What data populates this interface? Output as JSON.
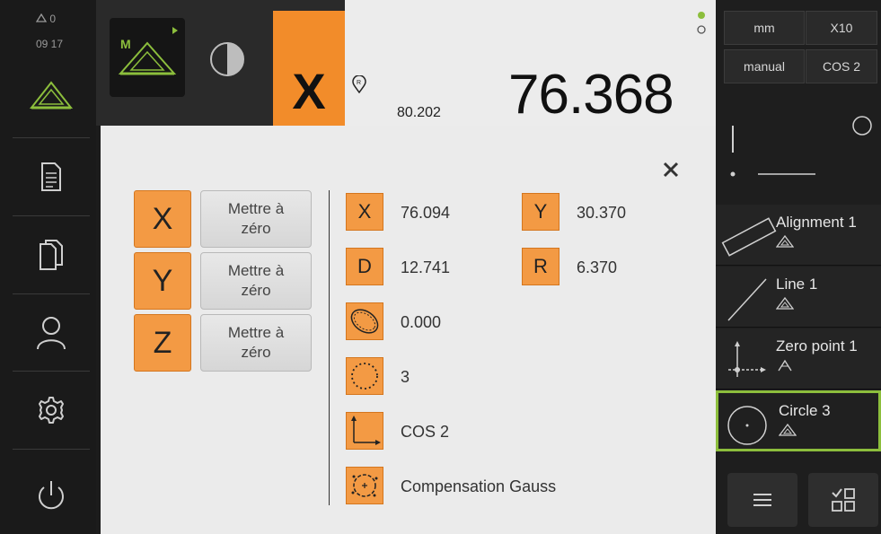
{
  "status": {
    "warnings": "0",
    "time": "09 17"
  },
  "sidebar": {
    "items": [
      {
        "icon": "measure-icon"
      },
      {
        "icon": "protocol-icon"
      },
      {
        "icon": "file-management-icon"
      },
      {
        "icon": "user-icon"
      },
      {
        "icon": "settings-icon"
      },
      {
        "icon": "power-icon"
      }
    ]
  },
  "workspace": {
    "mode_label": "M",
    "axis": "X",
    "small_value": "80.202",
    "big_value": "76.368"
  },
  "right_panel": {
    "unit": "mm",
    "zoom": "X10",
    "mode": "manual",
    "coord_system": "COS 2",
    "features": [
      {
        "label": "Alignment 1"
      },
      {
        "label": "Line 1"
      },
      {
        "label": "Zero point 1"
      },
      {
        "label": "Circle 3"
      }
    ]
  },
  "dialog": {
    "axes": [
      {
        "axis": "X",
        "button": "Mettre à zéro"
      },
      {
        "axis": "Y",
        "button": "Mettre à zéro"
      },
      {
        "axis": "Z",
        "button": "Mettre à zéro"
      }
    ],
    "x_label": "X",
    "x_value": "76.094",
    "y_label": "Y",
    "y_value": "30.370",
    "d_label": "D",
    "d_value": "12.741",
    "r_label": "R",
    "r_value": "6.370",
    "form_value": "0.000",
    "points_value": "3",
    "coord_value": "COS 2",
    "fit_value": "Compensation Gauss"
  },
  "colors": {
    "accent": "#f39a44",
    "selected": "#8cbe3c"
  }
}
